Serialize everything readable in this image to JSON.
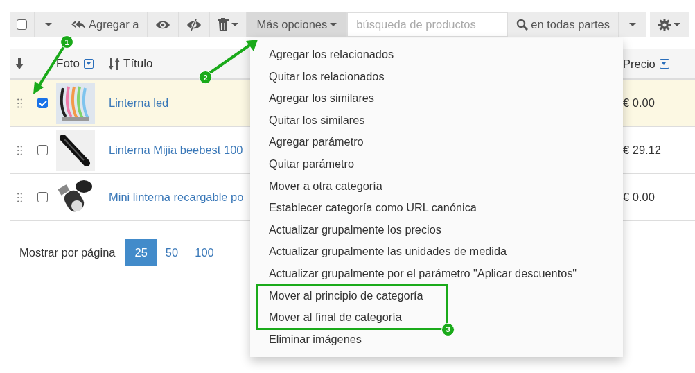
{
  "toolbar": {
    "select_all_checked": false,
    "add_to": "Agregar a",
    "more_options": {
      "label": "Más opciones",
      "expanded": true
    },
    "search": {
      "placeholder": "búsqueda de productos"
    },
    "search_scope": "en todas partes"
  },
  "table": {
    "columns": [
      "Foto",
      "Título",
      "Precio"
    ],
    "rows": [
      {
        "title": "Linterna led",
        "price": "€ 0.00",
        "checked": true
      },
      {
        "title": "Linterna Mijia beebest 100",
        "price": "€ 29.12",
        "checked": false
      },
      {
        "title": "Mini linterna recargable po",
        "price": "€ 0.00",
        "checked": false
      }
    ]
  },
  "menu": {
    "items": [
      {
        "label": "Agregar los relacionados",
        "boxed": false
      },
      {
        "label": "Quitar los relacionados",
        "boxed": false
      },
      {
        "label": "Agregar los similares",
        "boxed": false
      },
      {
        "label": "Quitar los similares",
        "boxed": false
      },
      {
        "label": "Agregar parámetro",
        "boxed": false
      },
      {
        "label": "Quitar parámetro",
        "boxed": false
      },
      {
        "label": "Mover a otra categoría",
        "boxed": false
      },
      {
        "label": "Establecer categoría como URL canónica",
        "boxed": false
      },
      {
        "label": "Actualizar grupalmente los precios",
        "boxed": false
      },
      {
        "label": "Actualizar grupalmente las unidades de medida",
        "boxed": false
      },
      {
        "label": "Actualizar grupalmente por el parámetro \"Aplicar descuentos\"",
        "boxed": false
      },
      {
        "label": "Mover al principio de categoría",
        "boxed": true
      },
      {
        "label": "Mover al final de categoría",
        "boxed": true
      },
      {
        "label": "Eliminar imágenes",
        "boxed": false
      }
    ]
  },
  "pagination": {
    "label": "Mostrar por página",
    "options": [
      {
        "label": "25",
        "selected": true
      },
      {
        "label": "50",
        "selected": false
      },
      {
        "label": "100",
        "selected": false
      }
    ]
  },
  "annotations": [
    {
      "number": "1"
    },
    {
      "number": "2"
    },
    {
      "number": "3"
    }
  ]
}
